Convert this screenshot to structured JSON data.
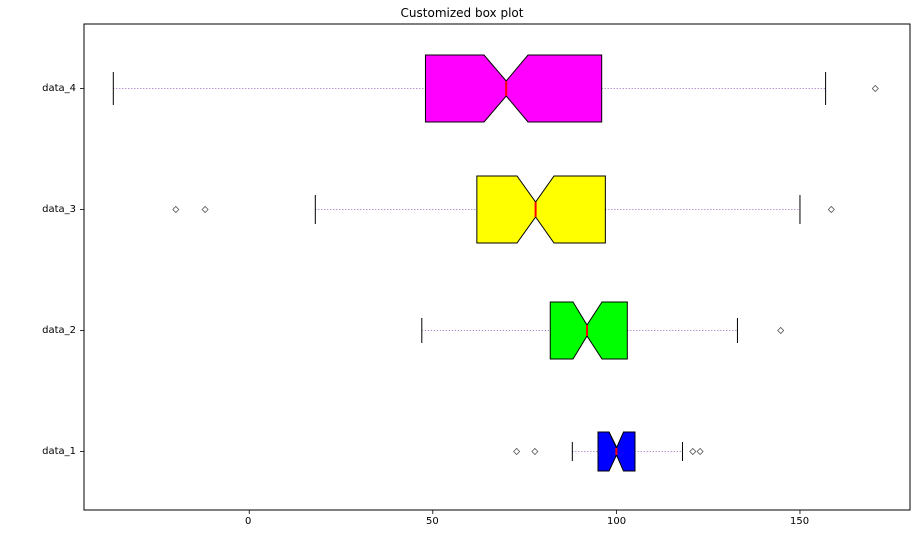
{
  "chart_data": {
    "type": "boxplot",
    "orientation": "horizontal",
    "title": "Customized box plot",
    "xlabel": "",
    "ylabel": "",
    "xlim": [
      -45,
      180
    ],
    "x_ticks": [
      0,
      50,
      100,
      150
    ],
    "y_categories": [
      "data_1",
      "data_2",
      "data_3",
      "data_4"
    ],
    "series": [
      {
        "name": "data_1",
        "color": "#0000ff",
        "q1": 95,
        "median": 100,
        "q3": 105,
        "whisker_low": 88,
        "whisker_high": 118,
        "fliers": [
          72,
          77,
          120,
          122
        ],
        "notch_low": 98,
        "notch_high": 102
      },
      {
        "name": "data_2",
        "color": "#00ff00",
        "q1": 82,
        "median": 92,
        "q3": 103,
        "whisker_low": 47,
        "whisker_high": 133,
        "fliers": [
          144
        ],
        "notch_low": 88,
        "notch_high": 96
      },
      {
        "name": "data_3",
        "color": "#ffff00",
        "q1": 62,
        "median": 78,
        "q3": 97,
        "whisker_low": 18,
        "whisker_high": 150,
        "fliers": [
          -20,
          -12,
          158
        ],
        "notch_low": 73,
        "notch_high": 83
      },
      {
        "name": "data_4",
        "color": "#ff00ff",
        "q1": 48,
        "median": 70,
        "q3": 96,
        "whisker_low": -37,
        "whisker_high": 157,
        "fliers": [
          170
        ],
        "notch_low": 64,
        "notch_high": 76
      }
    ]
  },
  "labels": {
    "title": "Customized box plot",
    "x_tick_0": "0",
    "x_tick_50": "50",
    "x_tick_100": "100",
    "x_tick_150": "150",
    "y_tick_1": "data_1",
    "y_tick_2": "data_2",
    "y_tick_3": "data_3",
    "y_tick_4": "data_4"
  }
}
